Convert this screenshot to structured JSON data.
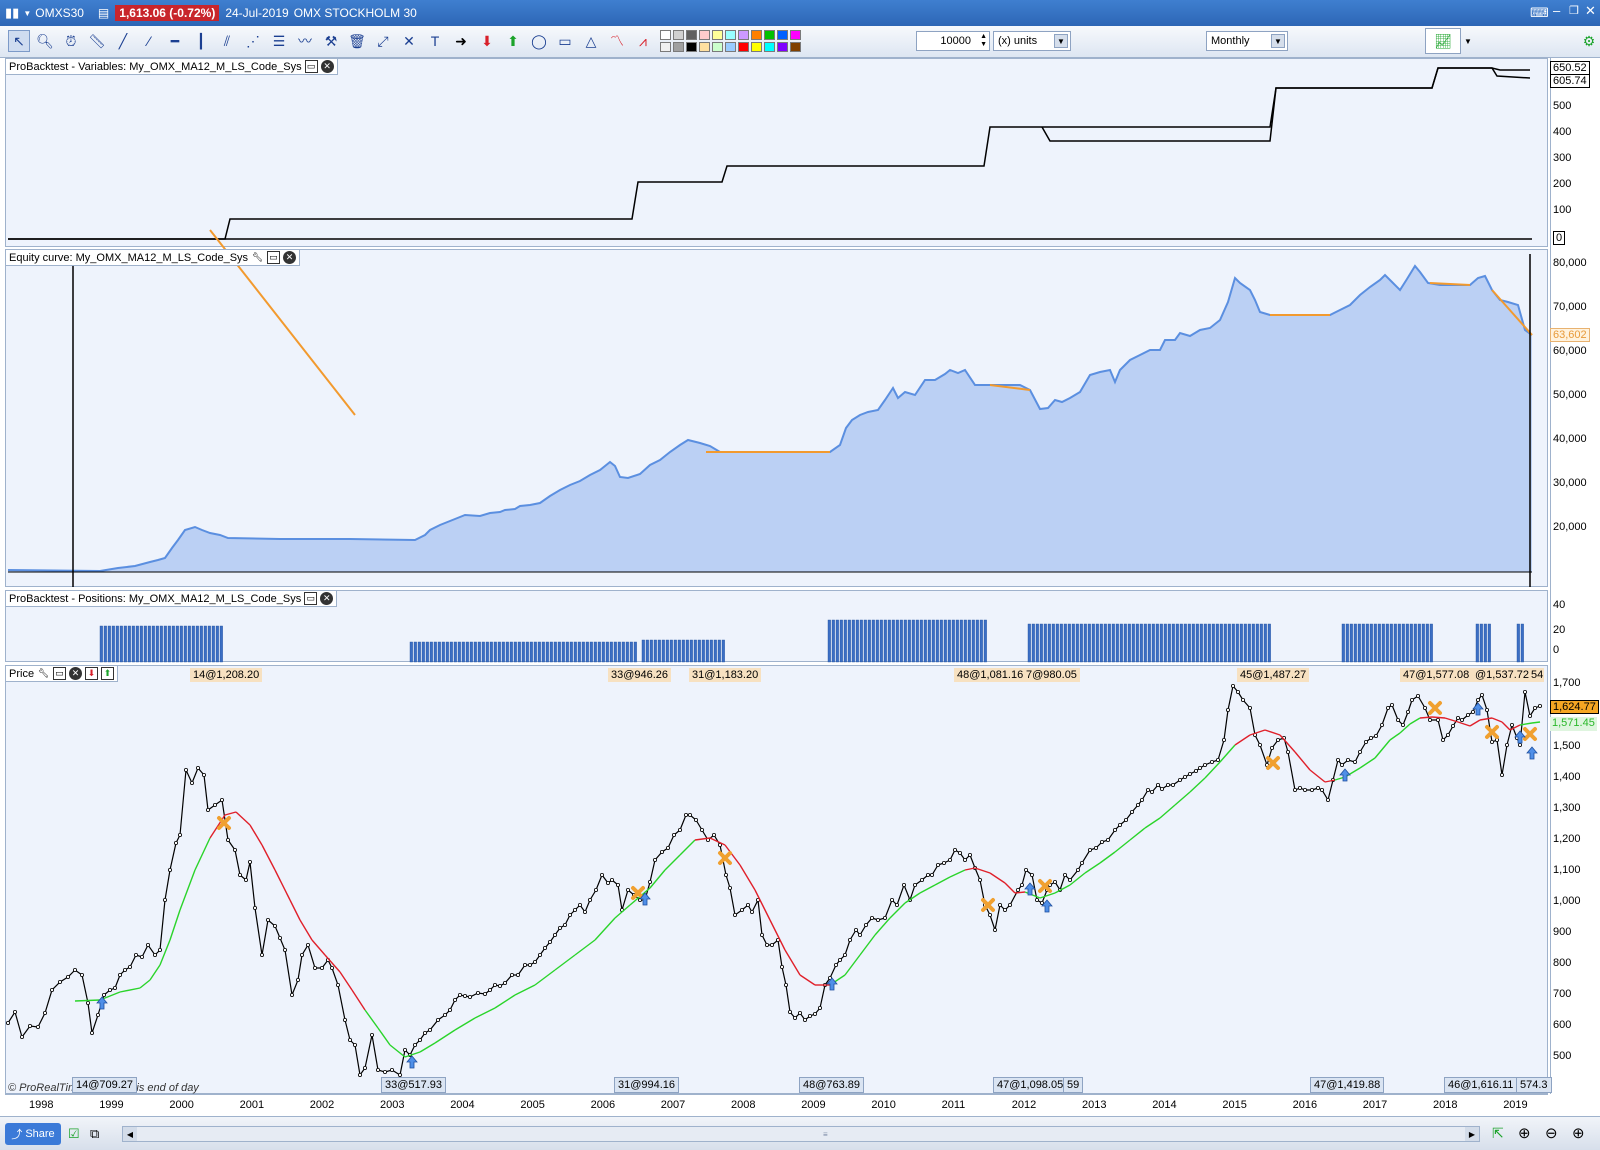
{
  "titlebar": {
    "symbol": "OMXS30",
    "price": "1,613.06 (-0.72%)",
    "date": "24-Jul-2019",
    "instrument": "OMX STOCKHOLM 30"
  },
  "toolbar": {
    "quantity": "10000",
    "units": "(x) units",
    "timeframe": "Monthly",
    "swatches": [
      "#ffffff",
      "#f0f0f0",
      "#d0d0d0",
      "#a0a0a0",
      "#606060",
      "#000000",
      "#ffcccc",
      "#ffe0a0",
      "#ffff99",
      "#ccffcc",
      "#99ffff",
      "#99ccff",
      "#cc99ff",
      "#ff0000",
      "#ff8000",
      "#ffff00",
      "#00c000",
      "#00ffff",
      "#0060ff",
      "#8000ff",
      "#ff00ff",
      "#804000"
    ]
  },
  "panels": {
    "variables": {
      "title": "ProBacktest - Variables: My_OMX_MA12_M_LS_Code_Sys",
      "ticks": [
        "500",
        "400",
        "300",
        "200",
        "100",
        "0"
      ],
      "labels": [
        "650.52",
        "605.74"
      ]
    },
    "equity": {
      "title": "Equity curve: My_OMX_MA12_M_LS_Code_Sys",
      "ticks": [
        "80,000",
        "70,000",
        "60,000",
        "50,000",
        "40,000",
        "30,000",
        "20,000"
      ],
      "label": "63,602"
    },
    "positions": {
      "title": "ProBacktest - Positions: My_OMX_MA12_M_LS_Code_Sys",
      "ticks": [
        "40",
        "20",
        "0"
      ]
    },
    "price": {
      "title": "Price",
      "ticks": [
        "1,700",
        "1,500",
        "1,400",
        "1,300",
        "1,200",
        "1,100",
        "1,000",
        "900",
        "800",
        "700",
        "600",
        "500"
      ],
      "labels": [
        "1,624.77",
        "1,571.45"
      ],
      "watermark": "© ProRealTime.com  Data is end of day",
      "top_annotations": [
        "14@1,208.20",
        "33@946.26",
        "31@1,183.20",
        "48@1,081.16",
        "7@980.05",
        "45@1,487.27",
        "47@1,577.08",
        "@1,537.72",
        "54"
      ],
      "bottom_annotations": [
        "14@709.27",
        "33@517.93",
        "31@994.16",
        "48@763.89",
        "47@1,098.05",
        "59",
        "47@1,419.88",
        "46@1,616.11",
        "574.3"
      ]
    }
  },
  "xaxis": {
    "years": [
      "1998",
      "1999",
      "2000",
      "2001",
      "2002",
      "2003",
      "2004",
      "2005",
      "2006",
      "2007",
      "2008",
      "2009",
      "2010",
      "2011",
      "2012",
      "2013",
      "2014",
      "2015",
      "2016",
      "2017",
      "2018",
      "2019"
    ]
  },
  "statusbar": {
    "share_label": "Share"
  },
  "colors": {
    "titlebar": "#2d66b5",
    "price_badge": "#c8252b",
    "equity_fill": "#a9c4f2",
    "equity_line_up": "#5b8fe0",
    "equity_line_flat": "#f29a2e",
    "ma_up": "#2ad42a",
    "ma_down": "#e0202a",
    "bars": "#3c6fc4"
  }
}
